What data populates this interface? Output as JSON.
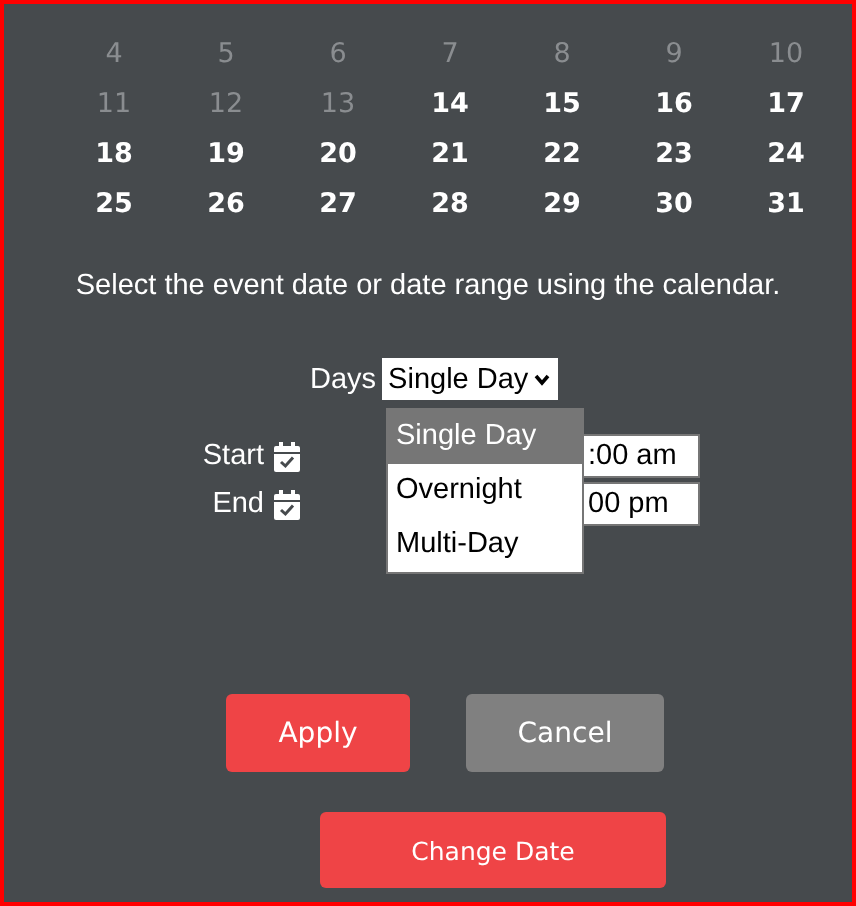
{
  "calendar": {
    "days": [
      {
        "label": "4",
        "disabled": true
      },
      {
        "label": "5",
        "disabled": true
      },
      {
        "label": "6",
        "disabled": true
      },
      {
        "label": "7",
        "disabled": true
      },
      {
        "label": "8",
        "disabled": true
      },
      {
        "label": "9",
        "disabled": true
      },
      {
        "label": "10",
        "disabled": true
      },
      {
        "label": "11",
        "disabled": true
      },
      {
        "label": "12",
        "disabled": true
      },
      {
        "label": "13",
        "disabled": true
      },
      {
        "label": "14",
        "disabled": false
      },
      {
        "label": "15",
        "disabled": false
      },
      {
        "label": "16",
        "disabled": false
      },
      {
        "label": "17",
        "disabled": false
      },
      {
        "label": "18",
        "disabled": false
      },
      {
        "label": "19",
        "disabled": false
      },
      {
        "label": "20",
        "disabled": false
      },
      {
        "label": "21",
        "disabled": false
      },
      {
        "label": "22",
        "disabled": false
      },
      {
        "label": "23",
        "disabled": false
      },
      {
        "label": "24",
        "disabled": false
      },
      {
        "label": "25",
        "disabled": false
      },
      {
        "label": "26",
        "disabled": false
      },
      {
        "label": "27",
        "disabled": false
      },
      {
        "label": "28",
        "disabled": false
      },
      {
        "label": "29",
        "disabled": false
      },
      {
        "label": "30",
        "disabled": false
      },
      {
        "label": "31",
        "disabled": false
      }
    ]
  },
  "instruction": "Select the event date or date range using the calendar.",
  "days_field": {
    "label": "Days",
    "value": "Single Day",
    "expanded": true,
    "options": [
      {
        "label": "Single Day",
        "selected": true
      },
      {
        "label": "Overnight",
        "selected": false
      },
      {
        "label": "Multi-Day",
        "selected": false
      }
    ]
  },
  "times": [
    {
      "label": "Start",
      "value": ":00 am"
    },
    {
      "label": "End",
      "value": "00 pm"
    }
  ],
  "buttons": [
    {
      "label": "Apply",
      "kind": "primary"
    },
    {
      "label": "Cancel",
      "kind": "secondary"
    }
  ],
  "change_date_button": "Change Date"
}
